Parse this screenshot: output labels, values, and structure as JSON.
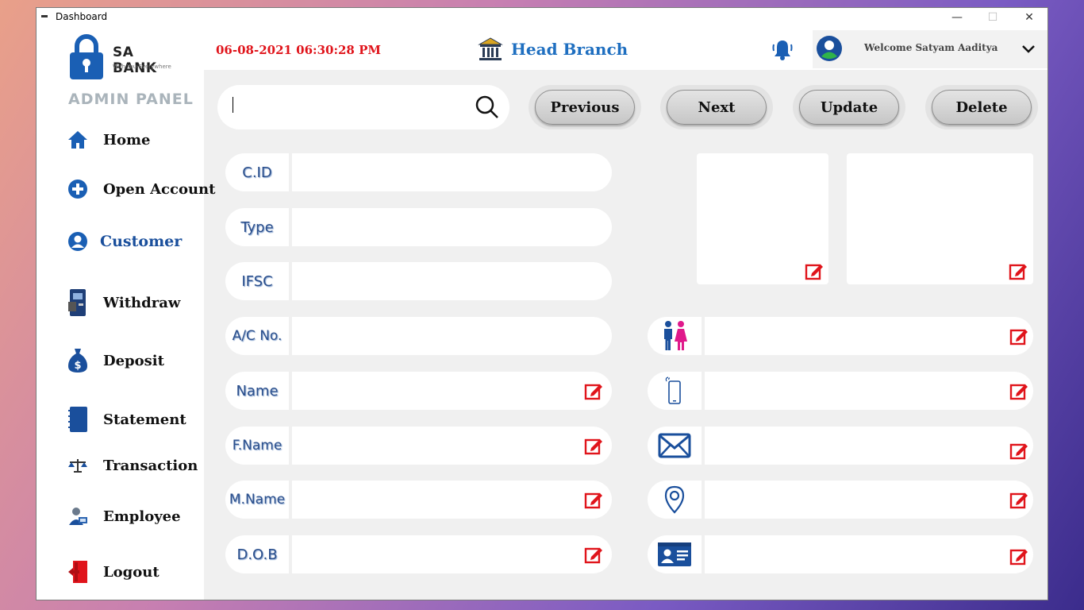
{
  "window": {
    "title": "Dashboard",
    "controls": [
      "—",
      "☐",
      "✕"
    ]
  },
  "sidebar": {
    "brand": "SA BANK",
    "tagline": "With You Everywhere",
    "panel_title": "ADMIN PANEL",
    "items": [
      {
        "label": "Home",
        "icon": "home-icon"
      },
      {
        "label": "Open Account",
        "icon": "plus-circle-icon"
      },
      {
        "label": "Customer",
        "icon": "user-circle-icon",
        "active": true
      },
      {
        "label": "Withdraw",
        "icon": "atm-icon"
      },
      {
        "label": "Deposit",
        "icon": "money-bag-icon"
      },
      {
        "label": "Statement",
        "icon": "notebook-icon"
      },
      {
        "label": "Transaction",
        "icon": "scale-icon"
      },
      {
        "label": "Employee",
        "icon": "employee-icon"
      },
      {
        "label": "Logout",
        "icon": "logout-icon"
      }
    ]
  },
  "header": {
    "datetime": "06-08-2021 06:30:28 PM",
    "branch": "Head Branch",
    "welcome": "Welcome Satyam Aaditya"
  },
  "search": {
    "value": "",
    "placeholder": ""
  },
  "buttons": {
    "previous": "Previous",
    "next": "Next",
    "update": "Update",
    "delete": "Delete"
  },
  "form": {
    "fields": [
      {
        "label": "C.ID",
        "value": "",
        "editable": false
      },
      {
        "label": "Type",
        "value": "",
        "editable": false
      },
      {
        "label": "IFSC",
        "value": "",
        "editable": false
      },
      {
        "label": "A/C No.",
        "value": "",
        "editable": false
      },
      {
        "label": "Name",
        "value": "",
        "editable": true
      },
      {
        "label": "F.Name",
        "value": "",
        "editable": true
      },
      {
        "label": "M.Name",
        "value": "",
        "editable": true
      },
      {
        "label": "D.O.B",
        "value": "",
        "editable": true
      }
    ],
    "right_fields": [
      {
        "icon": "gender-icon",
        "value": ""
      },
      {
        "icon": "phone-icon",
        "value": ""
      },
      {
        "icon": "mail-icon",
        "value": ""
      },
      {
        "icon": "location-pin-icon",
        "value": ""
      },
      {
        "icon": "id-card-icon",
        "value": ""
      }
    ]
  },
  "colors": {
    "accent_blue": "#1a4f9c",
    "datetime_red": "#e0141b",
    "edit_red": "#e0141b"
  }
}
